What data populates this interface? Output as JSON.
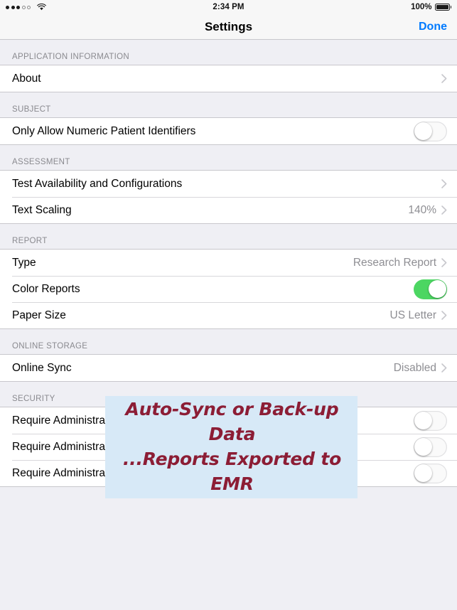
{
  "status_bar": {
    "signal_dots_filled": 3,
    "signal_dots_total": 5,
    "wifi_icon": "wifi-icon",
    "time": "2:34 PM",
    "battery_percent": "100%",
    "battery_icon": "battery-full-icon"
  },
  "nav": {
    "title": "Settings",
    "done_label": "Done"
  },
  "sections": [
    {
      "header": "APPLICATION INFORMATION",
      "rows": [
        {
          "label": "About",
          "type": "disclosure",
          "value": ""
        }
      ]
    },
    {
      "header": "SUBJECT",
      "rows": [
        {
          "label": "Only Allow Numeric Patient Identifiers",
          "type": "toggle",
          "value": "off"
        }
      ]
    },
    {
      "header": "ASSESSMENT",
      "rows": [
        {
          "label": "Test Availability and Configurations",
          "type": "disclosure",
          "value": ""
        },
        {
          "label": "Text Scaling",
          "type": "disclosure",
          "value": "140%"
        }
      ]
    },
    {
      "header": "REPORT",
      "rows": [
        {
          "label": "Type",
          "type": "disclosure",
          "value": "Research Report"
        },
        {
          "label": "Color Reports",
          "type": "toggle",
          "value": "on"
        },
        {
          "label": "Paper Size",
          "type": "disclosure",
          "value": "US Letter"
        }
      ]
    },
    {
      "header": "ONLINE STORAGE",
      "rows": [
        {
          "label": "Online Sync",
          "type": "disclosure",
          "value": "Disabled"
        }
      ]
    },
    {
      "header": "SECURITY",
      "rows": [
        {
          "label": "Require Administration Password to Access Settings",
          "type": "toggle",
          "value": "off"
        },
        {
          "label": "Require Administration Password at Session Completion",
          "type": "toggle",
          "value": "off"
        },
        {
          "label": "Require Administration Password to View Reports When Offline",
          "type": "toggle",
          "value": "off"
        }
      ]
    }
  ],
  "annotation": {
    "line1": "Auto-Sync or Back-up Data",
    "line2": "...Reports Exported to EMR",
    "text_color": "#8C1D35",
    "highlight_color": "#D7E9F7"
  },
  "colors": {
    "accent_blue": "#007AFF",
    "toggle_on_green": "#4CD662",
    "group_background": "#FFFFFF",
    "page_background": "#EFEFF4",
    "secondary_text": "#8E8E93",
    "separator": "#C8C7CC"
  }
}
